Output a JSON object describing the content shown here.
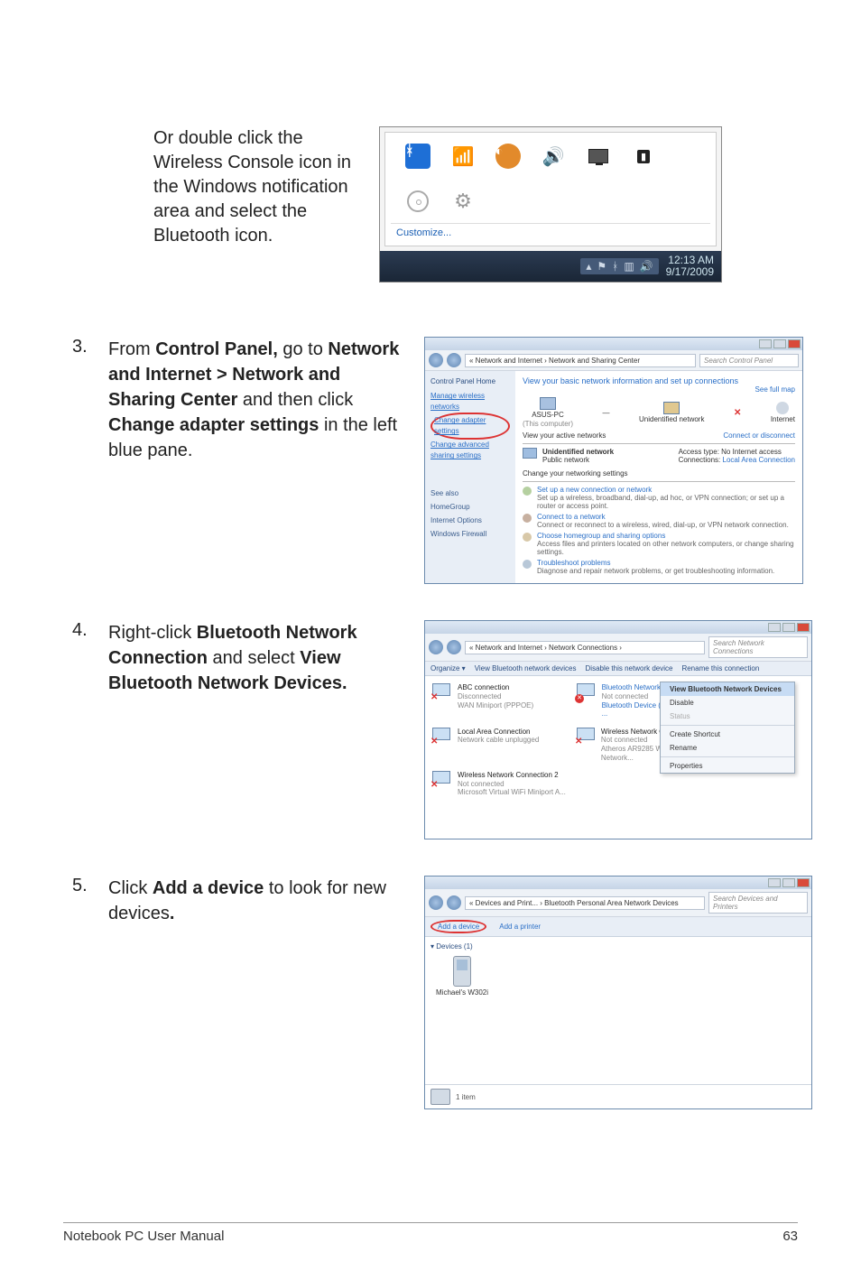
{
  "intro": "Or double click the Wireless Console icon in the Windows notification area and select the Bluetooth icon.",
  "tray": {
    "customize": "Customize...",
    "clock_time": "12:13 AM",
    "clock_date": "9/17/2009"
  },
  "step3": {
    "num": "3.",
    "text_pre": "From ",
    "b1": "Control Panel,",
    "t2": " go to ",
    "b2": "Network and Internet > Network and Sharing Center",
    "t3": " and then click ",
    "b3": "Change adapter settings",
    "t4": " in the left blue pane."
  },
  "nsc": {
    "addr": "« Network and Internet › Network and Sharing Center",
    "search": "Search Control Panel",
    "sidebar_home": "Control Panel Home",
    "sidebar_manage": "Manage wireless networks",
    "sidebar_change_adapter": "Change adapter settings",
    "sidebar_change_adv": "Change advanced sharing settings",
    "sidebar_seealso": "See also",
    "sidebar_homegroup": "HomeGroup",
    "sidebar_inet": "Internet Options",
    "sidebar_fw": "Windows Firewall",
    "heading": "View your basic network information and set up connections",
    "see_full_map": "See full map",
    "node_pc": "ASUS-PC",
    "node_pc_sub": "(This computer)",
    "node_unid": "Unidentified network",
    "node_inet": "Internet",
    "active_hdr": "View your active networks",
    "connect_disc": "Connect or disconnect",
    "unid_net": "Unidentified network",
    "pub_net": "Public network",
    "access": "Access type:",
    "access_v": "No Internet access",
    "connections": "Connections:",
    "connections_v": "Local Area Connection",
    "change_hdr": "Change your networking settings",
    "setup": "Set up a new connection or network",
    "setup_d": "Set up a wireless, broadband, dial-up, ad hoc, or VPN connection; or set up a router or access point.",
    "connect": "Connect to a network",
    "connect_d": "Connect or reconnect to a wireless, wired, dial-up, or VPN network connection.",
    "homegroup": "Choose homegroup and sharing options",
    "homegroup_d": "Access files and printers located on other network computers, or change sharing settings.",
    "trouble": "Troubleshoot problems",
    "trouble_d": "Diagnose and repair network problems, or get troubleshooting information."
  },
  "step4": {
    "num": "4.",
    "t1": "Right-click ",
    "b1": "Bluetooth Network Connection",
    "t2": " and select ",
    "b2": "View Bluetooth Network Devices."
  },
  "nc": {
    "addr": "« Network and Internet › Network Connections ›",
    "search": "Search Network Connections",
    "tb_org": "Organize ▾",
    "tb_view": "View Bluetooth network devices",
    "tb_disable": "Disable this network device",
    "tb_rename": "Rename this connection",
    "c1_t": "ABC connection",
    "c1_s1": "Disconnected",
    "c1_s2": "WAN Miniport (PPPOE)",
    "c2_t": "Bluetooth Network Connection",
    "c2_s1": "Not connected",
    "c2_s2": "Bluetooth Device (Personal Area ...",
    "c3_t": "Local Area Connection",
    "c3_s1": "Network cable unplugged",
    "c4_t": "Wireless Network Connection",
    "c4_s1": "Not connected",
    "c4_s2": "Atheros AR9285 Wireless Network...",
    "c5_t": "Wireless Network Connection 2",
    "c5_s1": "Not connected",
    "c5_s2": "Microsoft Virtual WiFi Miniport A...",
    "m_view": "View Bluetooth Network Devices",
    "m_disable": "Disable",
    "m_status": "Status",
    "m_shortcut": "Create Shortcut",
    "m_rename": "Rename",
    "m_prop": "Properties"
  },
  "step5": {
    "num": "5.",
    "t1": "Click ",
    "b1": "Add a device",
    "t2": " to look for new devices",
    "b2": "."
  },
  "dp": {
    "addr": "« Devices and Print... › Bluetooth Personal Area Network Devices",
    "search": "Search Devices and Printers",
    "add_device": "Add a device",
    "add_printer": "Add a printer",
    "section": "▾ Devices (1)",
    "dev_name": "Michael's W302i",
    "status": "1 item"
  },
  "footer_left": "Notebook PC User Manual",
  "footer_right": "63"
}
